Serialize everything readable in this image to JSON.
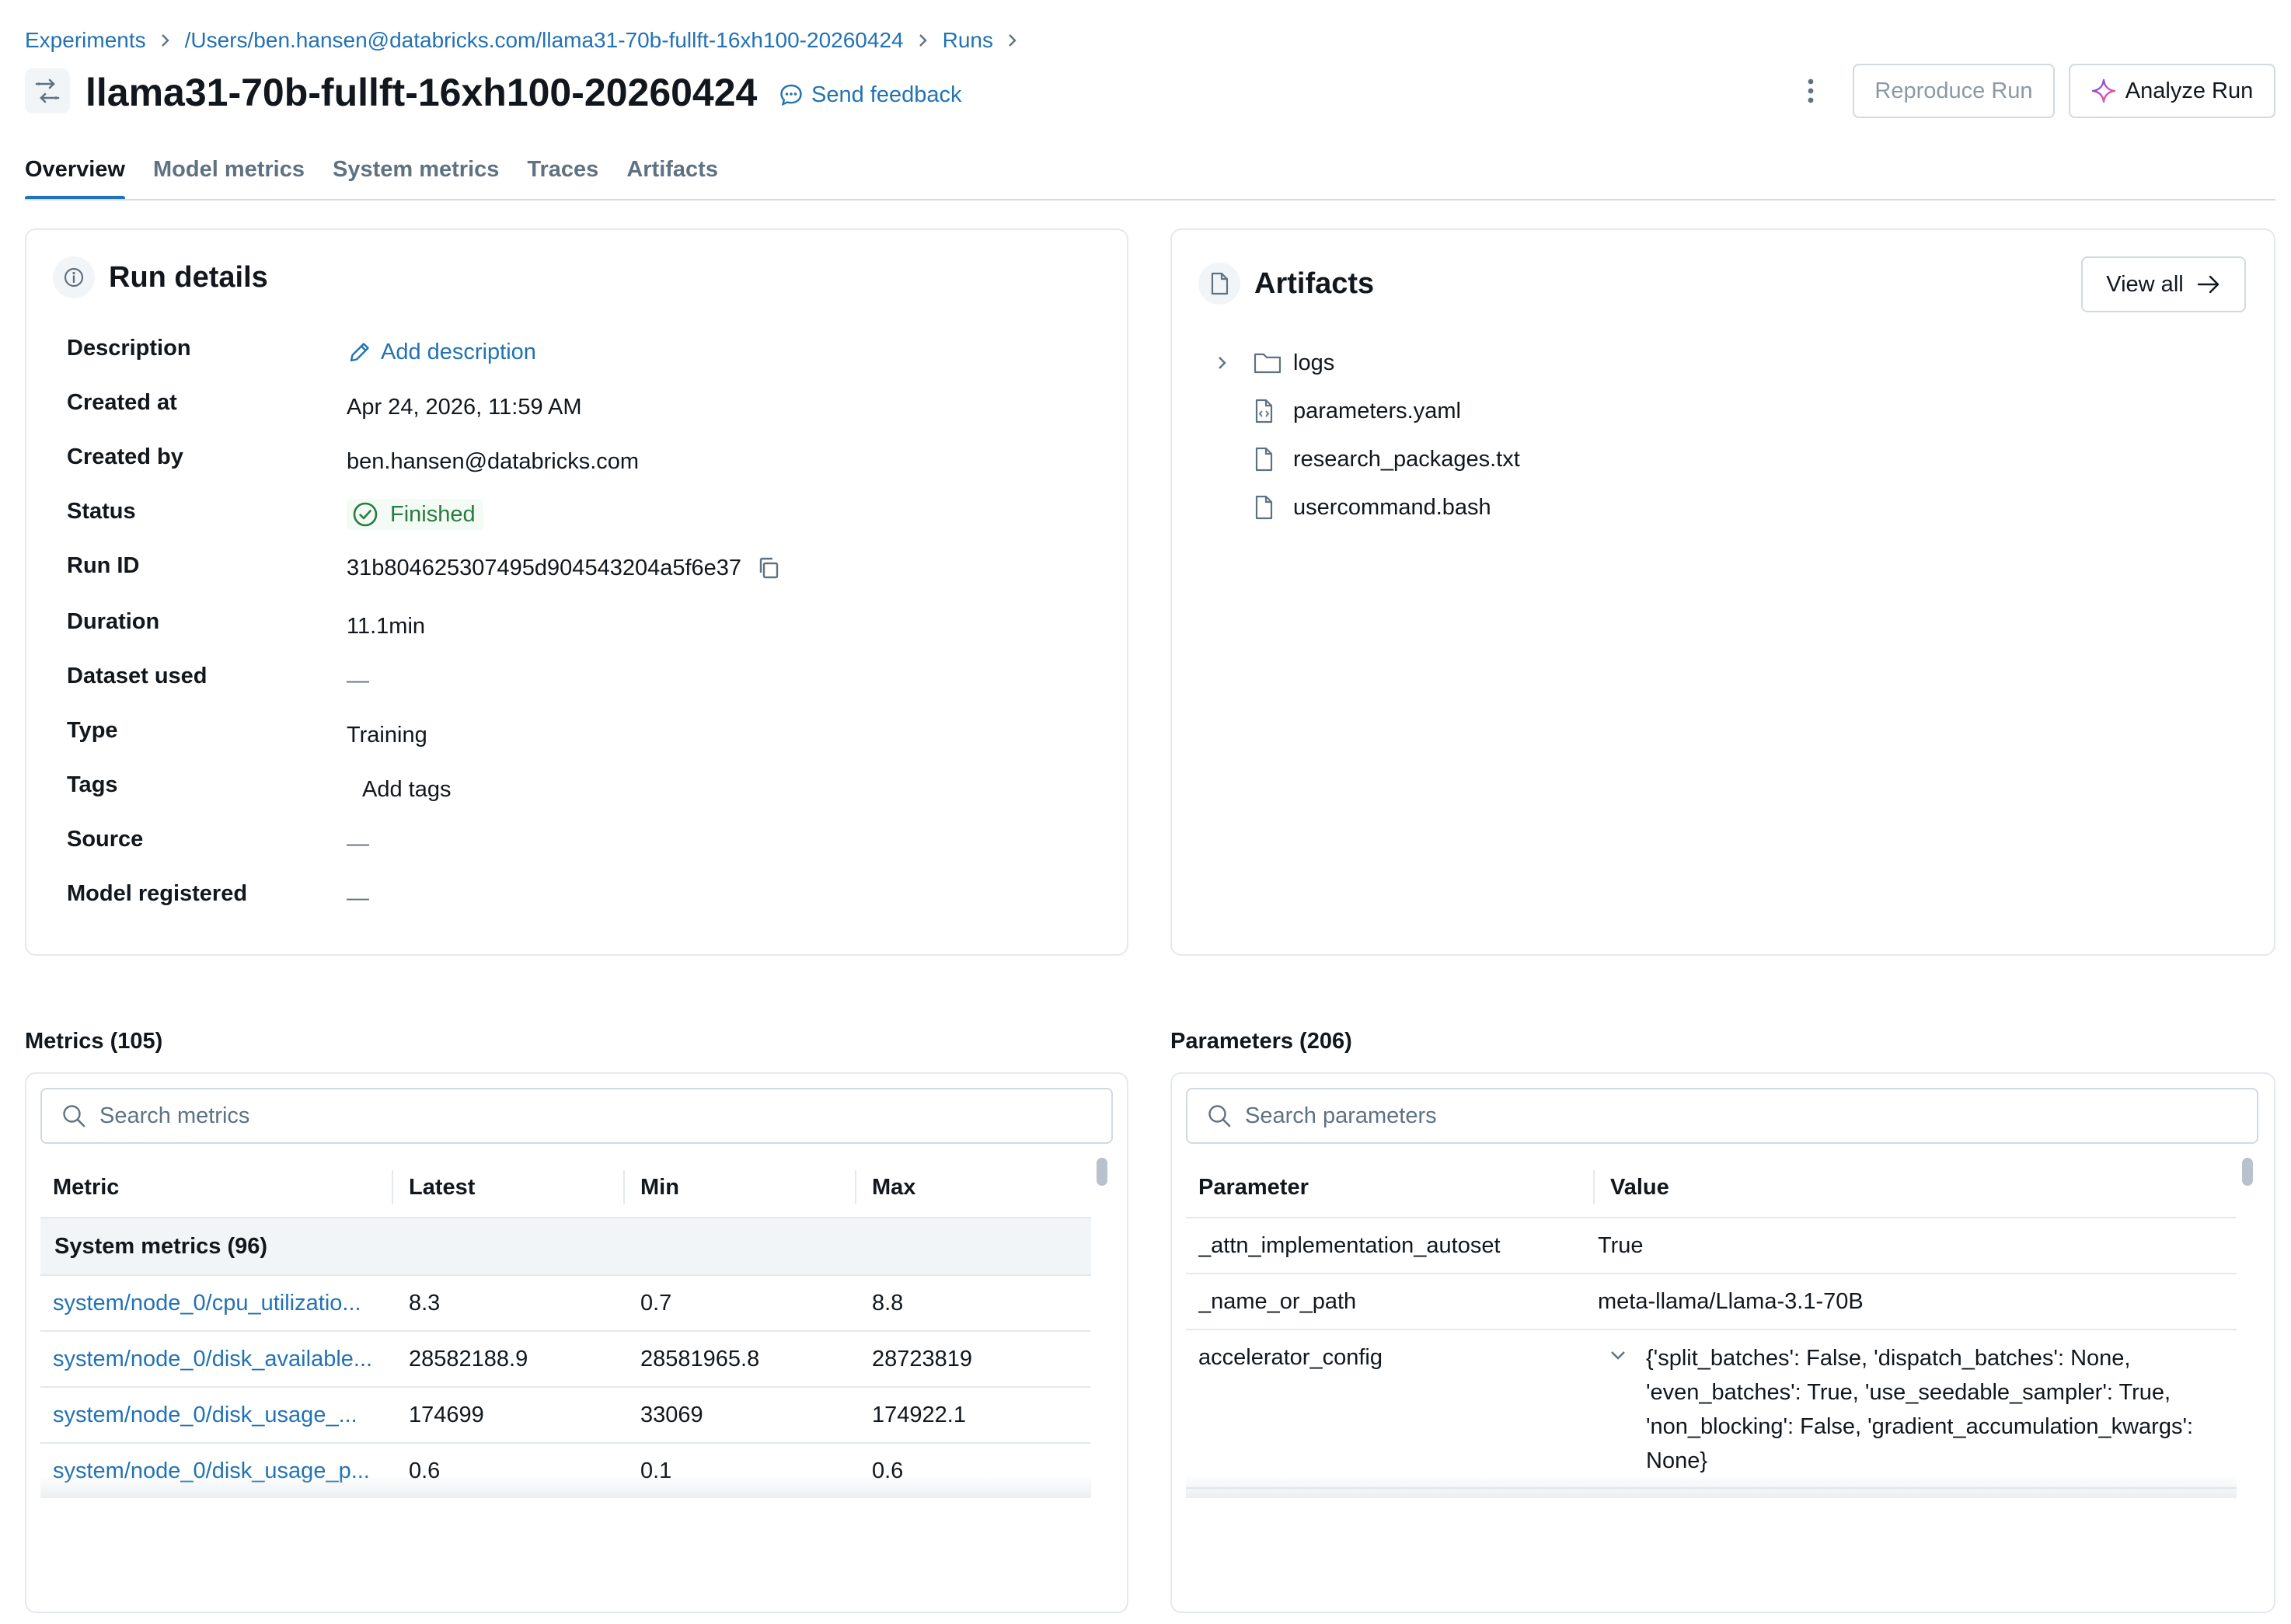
{
  "breadcrumb": {
    "items": [
      "Experiments",
      "/Users/ben.hansen@databricks.com/llama31-70b-fullft-16xh100-20260424",
      "Runs"
    ]
  },
  "header": {
    "title": "llama31-70b-fullft-16xh100-20260424",
    "feedback_label": "Send feedback",
    "reproduce_label": "Reproduce Run",
    "analyze_label": "Analyze Run"
  },
  "tabs": [
    {
      "label": "Overview",
      "active": true
    },
    {
      "label": "Model metrics",
      "active": false
    },
    {
      "label": "System metrics",
      "active": false
    },
    {
      "label": "Traces",
      "active": false
    },
    {
      "label": "Artifacts",
      "active": false
    }
  ],
  "run_details": {
    "title": "Run details",
    "rows": [
      {
        "label": "Description",
        "value": "Add description",
        "kind": "link-edit"
      },
      {
        "label": "Created at",
        "value": "Apr 24, 2026, 11:59 AM",
        "kind": "text"
      },
      {
        "label": "Created by",
        "value": "ben.hansen@databricks.com",
        "kind": "text"
      },
      {
        "label": "Status",
        "value": "Finished",
        "kind": "status"
      },
      {
        "label": "Run ID",
        "value": "31b804625307495d904543204a5f6e37",
        "kind": "copy"
      },
      {
        "label": "Duration",
        "value": "11.1min",
        "kind": "text"
      },
      {
        "label": "Dataset used",
        "value": "—",
        "kind": "text"
      },
      {
        "label": "Type",
        "value": "Training",
        "kind": "text"
      },
      {
        "label": "Tags",
        "value": "Add tags",
        "kind": "link"
      },
      {
        "label": "Source",
        "value": "—",
        "kind": "text"
      },
      {
        "label": "Model registered",
        "value": "—",
        "kind": "text"
      }
    ]
  },
  "artifacts": {
    "title": "Artifacts",
    "view_all_label": "View all",
    "items": [
      {
        "name": "logs",
        "type": "folder"
      },
      {
        "name": "parameters.yaml",
        "type": "code-file"
      },
      {
        "name": "research_packages.txt",
        "type": "file"
      },
      {
        "name": "usercommand.bash",
        "type": "file"
      }
    ]
  },
  "metrics": {
    "title": "Metrics (105)",
    "search_placeholder": "Search metrics",
    "columns": [
      "Metric",
      "Latest",
      "Min",
      "Max"
    ],
    "group_label": "System metrics (96)",
    "rows": [
      {
        "name": "system/node_0/cpu_utilizatio...",
        "latest": "8.3",
        "min": "0.7",
        "max": "8.8"
      },
      {
        "name": "system/node_0/disk_available...",
        "latest": "28582188.9",
        "min": "28581965.8",
        "max": "28723819"
      },
      {
        "name": "system/node_0/disk_usage_...",
        "latest": "174699",
        "min": "33069",
        "max": "174922.1"
      },
      {
        "name": "system/node_0/disk_usage_p...",
        "latest": "0.6",
        "min": "0.1",
        "max": "0.6"
      }
    ]
  },
  "parameters": {
    "title": "Parameters (206)",
    "search_placeholder": "Search parameters",
    "columns": [
      "Parameter",
      "Value"
    ],
    "rows": [
      {
        "name": "_attn_implementation_autoset",
        "value": "True"
      },
      {
        "name": "_name_or_path",
        "value": "meta-llama/Llama-3.1-70B"
      },
      {
        "name": "accelerator_config",
        "value": "{'split_batches': False, 'dispatch_batches': None, 'even_batches': True, 'use_seedable_sampler': True, 'non_blocking': False, 'gradient_accumulation_kwargs': None}"
      }
    ]
  }
}
